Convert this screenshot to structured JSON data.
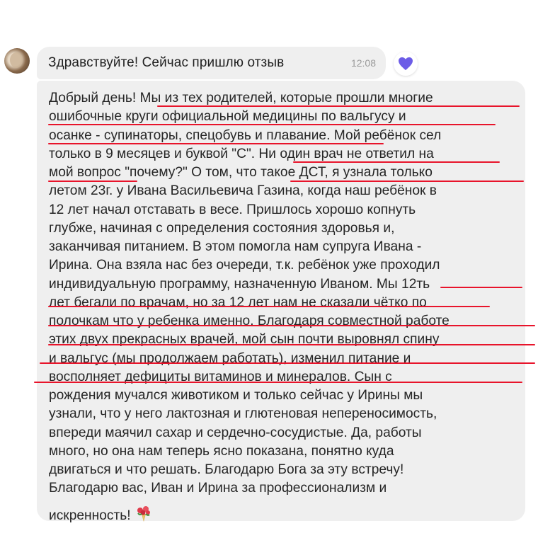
{
  "chat": {
    "messages": [
      {
        "text": "Здравствуйте! Сейчас пришлю отзыв",
        "time": "12:08",
        "reaction": "heart-icon",
        "reaction_color": "#6c5ce7"
      },
      {
        "lines": [
          "Добрый день! Мы из тех родителей, которые прошли многие",
          "ошибочные круги официальной медицины по вальгусу и",
          "осанке - супинаторы, спецобувь и плавание. Мой ребёнок сел",
          "только в 9 месяцев и буквой \"С\". Ни один врач не ответил на",
          "мой вопрос \"почему?\" О том, что такое ДСТ, я узнала только",
          "летом 23г. у Ивана Васильевича Газина, когда наш ребёнок в",
          "12 лет начал отставать в весе. Пришлось хорошо копнуть",
          "глубже, начиная с определения состояния здоровья и,",
          "заканчивая питанием. В этом помогла нам супруга Ивана -",
          "Ирина. Она взяла нас без очереди, т.к. ребёнок уже проходил",
          "индивидуальную программу, назначенную Иваном. Мы 12ть",
          "лет бегали по врачам, но за 12 лет нам не сказали чётко по",
          "полочкам что у ребенка именно. Благодаря совместной работе",
          "этих двух прекрасных врачей, мой сын почти выровнял спину",
          "и вальгус (мы продолжаем работать), изменил питание и",
          "восполняет дефициты витаминов и минералов. Сын с",
          "рождения мучался животиком и только сейчас у Ирины мы",
          "узнали, что у него лактозная и глютеновая непереносимость,",
          "впереди маячил сахар и сердечно-сосудистые. Да, работы",
          "много, но она нам теперь ясно показана, понятно куда",
          "двигаться и что решать. Благодарю Бога за эту встречу!",
          "Благодарю вас, Иван и Ирина за профессионализм и",
          "искренность!"
        ],
        "emoji": "bouquet-icon"
      }
    ]
  },
  "colors": {
    "bubble": "#efefef",
    "underline": "#e8142b"
  }
}
